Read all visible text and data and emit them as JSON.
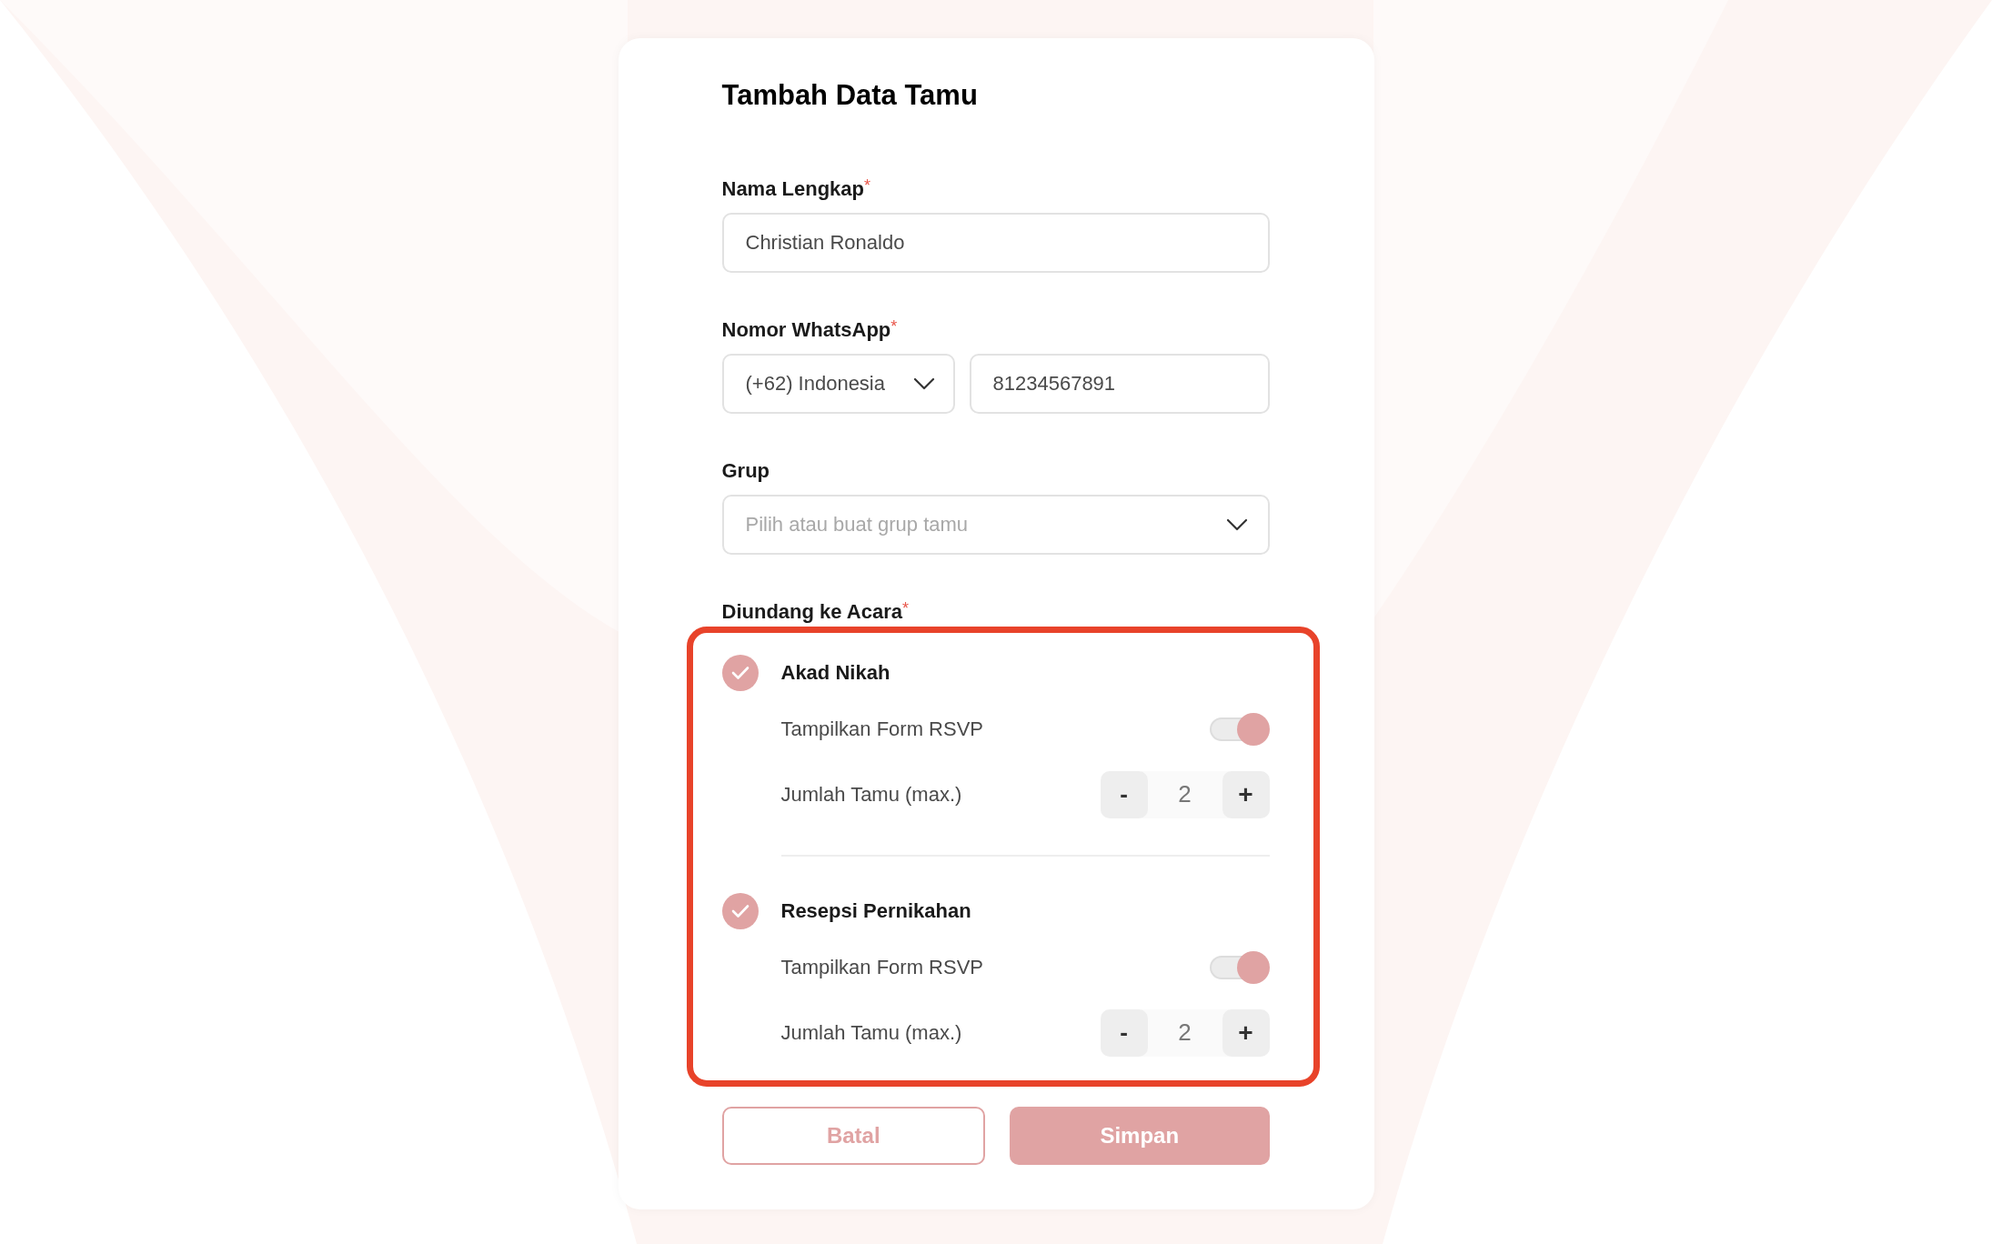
{
  "form": {
    "title": "Tambah Data Tamu",
    "name_field": {
      "label": "Nama Lengkap",
      "required_mark": "*",
      "value": "Christian Ronaldo"
    },
    "whatsapp_field": {
      "label": "Nomor WhatsApp",
      "required_mark": "*",
      "country": "(+62) Indonesia",
      "value": "81234567891"
    },
    "group_field": {
      "label": "Grup",
      "placeholder": "Pilih atau buat grup tamu"
    },
    "events_section": {
      "label": "Diundang ke Acara",
      "required_mark": "*",
      "highlighted": true,
      "events": [
        {
          "name": "Akad Nikah",
          "checked": true,
          "rsvp_label": "Tampilkan Form RSVP",
          "rsvp_on": true,
          "guests_label": "Jumlah Tamu (max.)",
          "minus": "-",
          "guests": "2",
          "plus": "+"
        },
        {
          "name": "Resepsi Pernikahan",
          "checked": true,
          "rsvp_label": "Tampilkan Form RSVP",
          "rsvp_on": true,
          "guests_label": "Jumlah Tamu (max.)",
          "minus": "-",
          "guests": "2",
          "plus": "+"
        }
      ]
    },
    "buttons": [
      {
        "kind": "outline",
        "label": "Batal"
      },
      {
        "kind": "filled",
        "label": "Simpan"
      }
    ]
  }
}
